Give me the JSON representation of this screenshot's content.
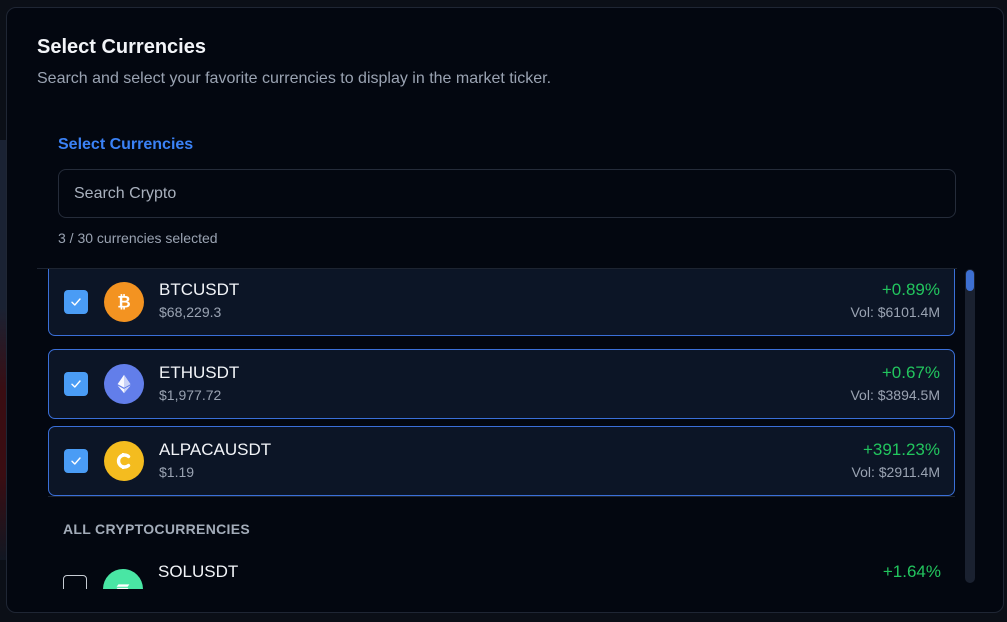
{
  "dialog": {
    "title": "Select Currencies",
    "description": "Search and select your favorite currencies to display in the market ticker."
  },
  "selector": {
    "label": "Select Currencies",
    "search_placeholder": "Search Crypto",
    "counter": "3 / 30 currencies selected"
  },
  "selected": [
    {
      "symbol": "BTCUSDT",
      "price": "$68,229.3",
      "change": "+0.89%",
      "volume": "Vol: $6101.4M",
      "icon": "bitcoin-icon",
      "checked": true
    },
    {
      "symbol": "ETHUSDT",
      "price": "$1,977.72",
      "change": "+0.67%",
      "volume": "Vol: $3894.5M",
      "icon": "ethereum-icon",
      "checked": true
    },
    {
      "symbol": "ALPACAUSDT",
      "price": "$1.19",
      "change": "+391.23%",
      "volume": "Vol: $2911.4M",
      "icon": "alpaca-icon",
      "checked": true
    }
  ],
  "all_label": "ALL CRYPTOCURRENCIES",
  "all": [
    {
      "symbol": "SOLUSDT",
      "change": "+1.64%",
      "icon": "solana-icon",
      "checked": false
    }
  ],
  "colors": {
    "accent": "#3b82f6",
    "positive": "#22c55e",
    "card_border": "#3a6fd8",
    "checkbox": "#4a9cf5"
  }
}
